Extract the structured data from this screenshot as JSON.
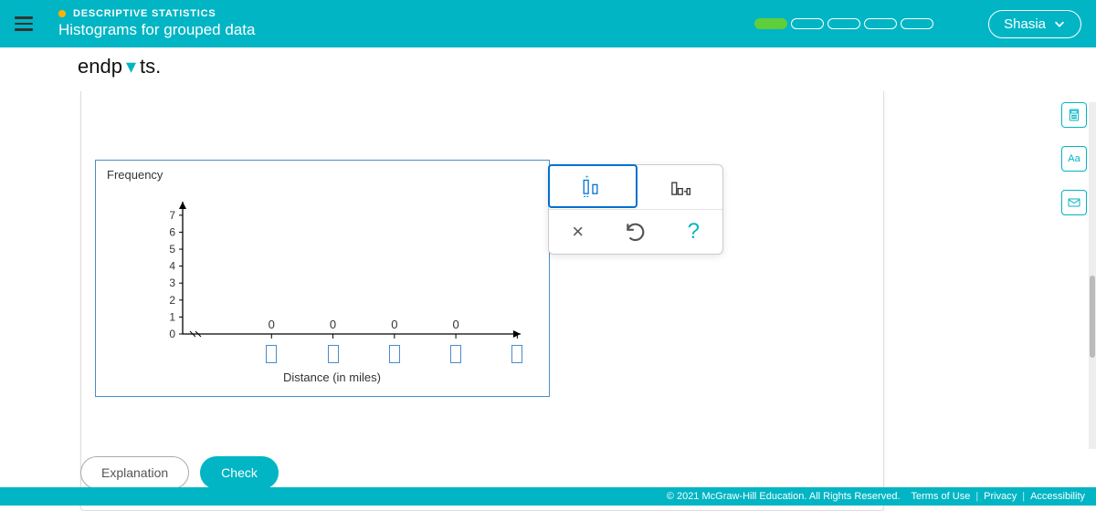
{
  "header": {
    "category": "DESCRIPTIVE STATISTICS",
    "topic": "Histograms for grouped data",
    "user": "Shasia",
    "progress_total": 5,
    "progress_done": 1
  },
  "fragment": {
    "left": "endp",
    "right": "ts."
  },
  "toolbar": {
    "reset_label": "Reset",
    "help_label": "?",
    "close_label": "×",
    "tool1": "insert-bar",
    "tool2": "adjust-bar"
  },
  "buttons": {
    "explanation": "Explanation",
    "check": "Check"
  },
  "right_rail": {
    "calculator": "calc",
    "font": "Aa",
    "mail": "mail"
  },
  "footer": {
    "copyright": "© 2021 McGraw-Hill Education. All Rights Reserved.",
    "terms": "Terms of Use",
    "privacy": "Privacy",
    "accessibility": "Accessibility"
  },
  "chart_data": {
    "type": "bar",
    "title": "",
    "xlabel": "Distance (in miles)",
    "ylabel": "Frequency",
    "y_ticks": [
      0,
      1,
      2,
      3,
      4,
      5,
      6,
      7
    ],
    "ylim": [
      0,
      7.8
    ],
    "x_tick_count": 5,
    "bar_labels": [
      "0",
      "0",
      "0",
      "0"
    ],
    "values": [
      0,
      0,
      0,
      0
    ],
    "x_tick_inputs_empty": true
  }
}
